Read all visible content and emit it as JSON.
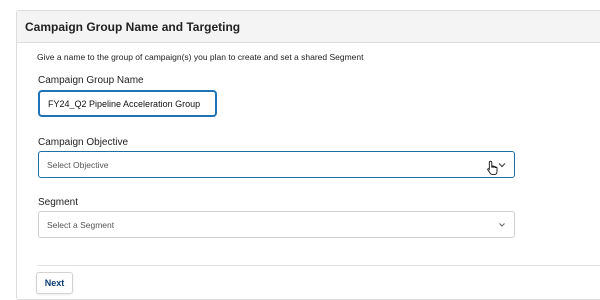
{
  "panel": {
    "title": "Campaign Group Name and Targeting",
    "help_text": "Give a name to the group of campaign(s) you plan to create and set a shared Segment"
  },
  "group_name": {
    "label": "Campaign Group Name",
    "value": "FY24_Q2 Pipeline Acceleration Group"
  },
  "objective": {
    "label": "Campaign Objective",
    "placeholder": "Select Objective",
    "icon": "chevron-down-icon"
  },
  "segment": {
    "label": "Segment",
    "placeholder": "Select a Segment",
    "icon": "chevron-down-icon"
  },
  "actions": {
    "next_label": "Next"
  },
  "colors": {
    "focus_border": "#1d74b7",
    "next_text": "#0b3d73",
    "header_bg": "#f4f4f4"
  }
}
